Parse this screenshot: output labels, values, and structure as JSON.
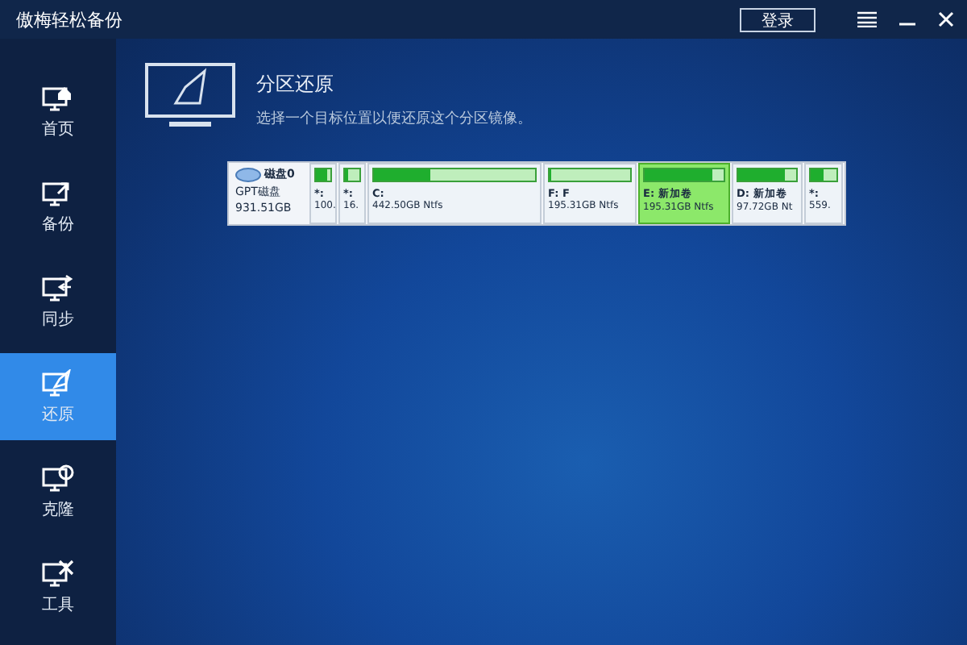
{
  "window": {
    "title": "傲梅轻松备份",
    "login_button": "登录"
  },
  "sidebar": {
    "items": [
      {
        "label": "首页",
        "selected": false
      },
      {
        "label": "备份",
        "selected": false
      },
      {
        "label": "同步",
        "selected": false
      },
      {
        "label": "还原",
        "selected": true
      },
      {
        "label": "克隆",
        "selected": false
      },
      {
        "label": "工具",
        "selected": false
      }
    ]
  },
  "header": {
    "title": "分区还原",
    "description": "选择一个目标位置以便还原这个分区镜像。"
  },
  "disk": {
    "name": "磁盘0",
    "type": "GPT磁盘",
    "size": "931.51GB",
    "partitions": [
      {
        "name": "*:",
        "info": "100.",
        "level": 0.8,
        "selected": false
      },
      {
        "name": "*:",
        "info": "16.",
        "level": 0.2,
        "selected": false
      },
      {
        "name": "C:",
        "info": "442.50GB Ntfs",
        "level": 0.35,
        "selected": false
      },
      {
        "name": "F: F",
        "info": "195.31GB Ntfs",
        "level": 0.02,
        "selected": false
      },
      {
        "name": "E: 新加卷",
        "info": "195.31GB Ntfs",
        "level": 0.85,
        "selected": true
      },
      {
        "name": "D: 新加卷",
        "info": "97.72GB Nt",
        "level": 0.8,
        "selected": false
      },
      {
        "name": "*:",
        "info": "559.",
        "level": 0.5,
        "selected": false
      }
    ]
  }
}
